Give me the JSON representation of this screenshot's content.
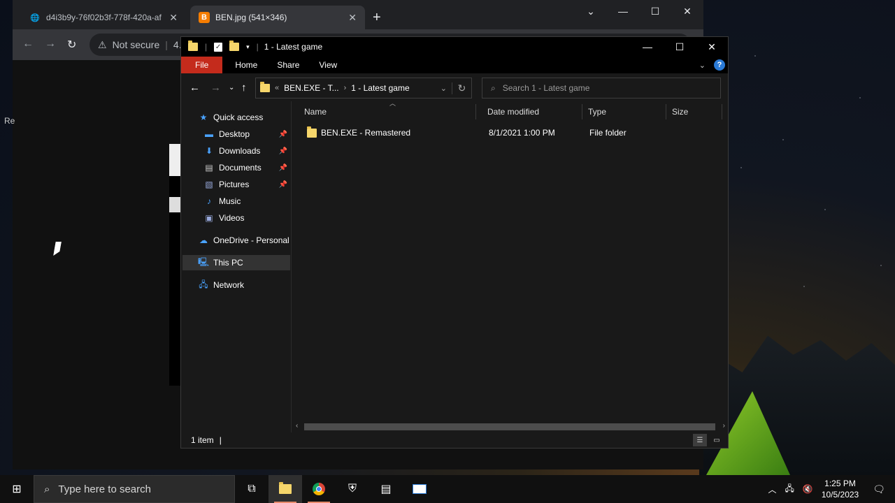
{
  "browser": {
    "tabs": [
      {
        "title": "d4i3b9y-76f02b3f-778f-420a-af",
        "favicon": "globe-icon"
      },
      {
        "title": "BEN.jpg (541×346)",
        "favicon": "blogger-icon"
      }
    ],
    "address_security": "Not secure",
    "address_text": "4.",
    "page_side_text": "Re"
  },
  "explorer": {
    "title": "1 - Latest game",
    "ribbon_tabs": [
      "File",
      "Home",
      "Share",
      "View"
    ],
    "breadcrumb": [
      "BEN.EXE - T...",
      "1 - Latest game"
    ],
    "breadcrumb_prefix": "«",
    "search_placeholder": "Search 1 - Latest game",
    "nav": {
      "quick_access": "Quick access",
      "items": [
        {
          "label": "Desktop",
          "icon": "desktop-icon",
          "pinned": true
        },
        {
          "label": "Downloads",
          "icon": "downloads-icon",
          "pinned": true
        },
        {
          "label": "Documents",
          "icon": "documents-icon",
          "pinned": true
        },
        {
          "label": "Pictures",
          "icon": "pictures-icon",
          "pinned": true
        },
        {
          "label": "Music",
          "icon": "music-icon",
          "pinned": false
        },
        {
          "label": "Videos",
          "icon": "videos-icon",
          "pinned": false
        }
      ],
      "onedrive": "OneDrive - Personal",
      "this_pc": "This PC",
      "network": "Network"
    },
    "columns": [
      "Name",
      "Date modified",
      "Type",
      "Size"
    ],
    "files": [
      {
        "name": "BEN.EXE - Remastered",
        "date": "8/1/2021 1:00 PM",
        "type": "File folder",
        "size": ""
      }
    ],
    "status": "1 item"
  },
  "taskbar": {
    "search_placeholder": "Type here to search",
    "time": "1:25 PM",
    "date": "10/5/2023"
  },
  "colors": {
    "file_tab": "#c42b1c",
    "folder": "#f6d66b",
    "accent_running": "#e88a6b"
  }
}
